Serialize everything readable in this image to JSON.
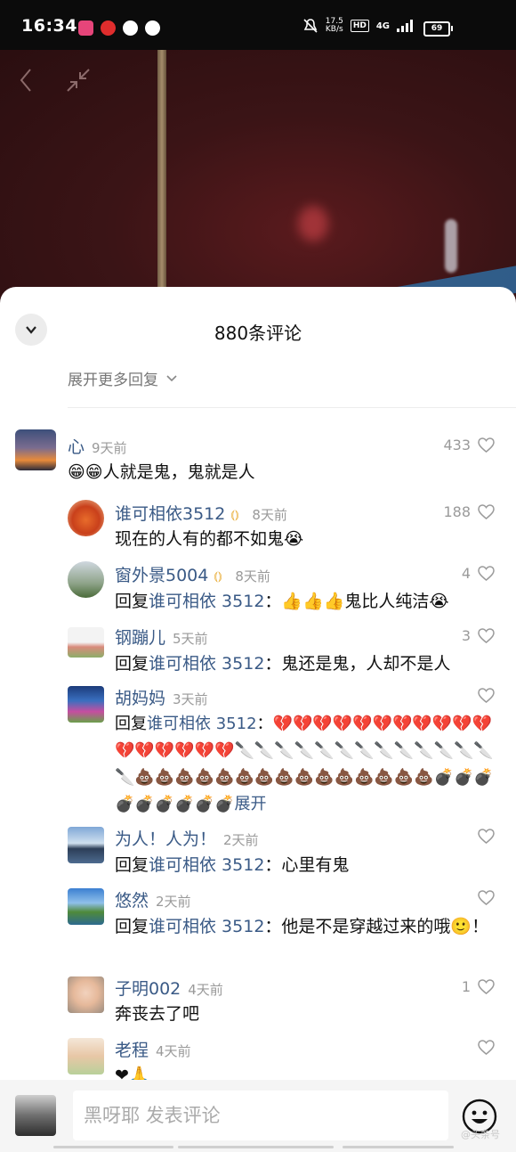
{
  "status_bar": {
    "time": "16:34",
    "speed_value": "17.5",
    "speed_unit": "KB/s",
    "hd": "HD",
    "network": "4G",
    "battery": "69",
    "icons": [
      "lala-app-icon",
      "netease-music-icon",
      "wechat-icon",
      "navigation-icon",
      "bell-off-icon",
      "signal-icon",
      "battery-icon"
    ]
  },
  "video": {
    "back_icon": "chevron-left-icon",
    "shrink_icon": "collapse-arrows-icon"
  },
  "comments_sheet": {
    "title": "880条评论",
    "expand_label": "展开更多回复",
    "comments": [
      {
        "id": "c1",
        "user": "心",
        "time": "9天前",
        "likes": "433",
        "text": "😁😁人就是鬼，鬼就是人"
      },
      {
        "id": "r1",
        "user": "谁可相依3512",
        "badge": true,
        "time": "8天前",
        "likes": "188",
        "text": "现在的人有的都不如鬼😭"
      },
      {
        "id": "r2",
        "user": "窗外景5004",
        "badge": true,
        "time": "8天前",
        "likes": "4",
        "reply_prefix": "回复",
        "reply_target": "谁可相依 3512",
        "text": "：👍👍👍鬼比人纯洁😭"
      },
      {
        "id": "r3",
        "user": "钢蹦儿",
        "time": "5天前",
        "likes": "3",
        "reply_prefix": "回复",
        "reply_target": "谁可相依 3512",
        "text": "：鬼还是鬼，人却不是人"
      },
      {
        "id": "r4",
        "user": "胡妈妈",
        "time": "3天前",
        "likes": "",
        "reply_prefix": "回复",
        "reply_target": "谁可相依 3512",
        "text": "：💔💔💔💔💔💔💔💔💔💔💔💔💔💔💔💔💔🔪🔪🔪🔪🔪🔪🔪🔪🔪🔪🔪🔪🔪🔪💩💩💩💩💩💩💩💩💩💩💩💩💩💩💩💣💣💣💣💣💣💣💣💣",
        "more": "展开"
      },
      {
        "id": "r5",
        "user": "为人！人为！",
        "time": "2天前",
        "likes": "",
        "reply_prefix": "回复",
        "reply_target": "谁可相依 3512",
        "text": "：心里有鬼"
      },
      {
        "id": "r6",
        "user": "悠然",
        "time": "2天前",
        "likes": "",
        "reply_prefix": "回复",
        "reply_target": "谁可相依 3512",
        "text": "：他是不是穿越过来的哦🙂！"
      },
      {
        "id": "r7",
        "user": "子明002",
        "time": "4天前",
        "likes": "1",
        "text": "奔丧去了吧"
      },
      {
        "id": "r8",
        "user": "老程",
        "time": "4天前",
        "likes": "",
        "text": "❤🙏"
      }
    ]
  },
  "composer": {
    "placeholder": "黑呀耶  发表评论",
    "emoji_icon": "smiley-icon"
  },
  "watermark": "@头条号"
}
